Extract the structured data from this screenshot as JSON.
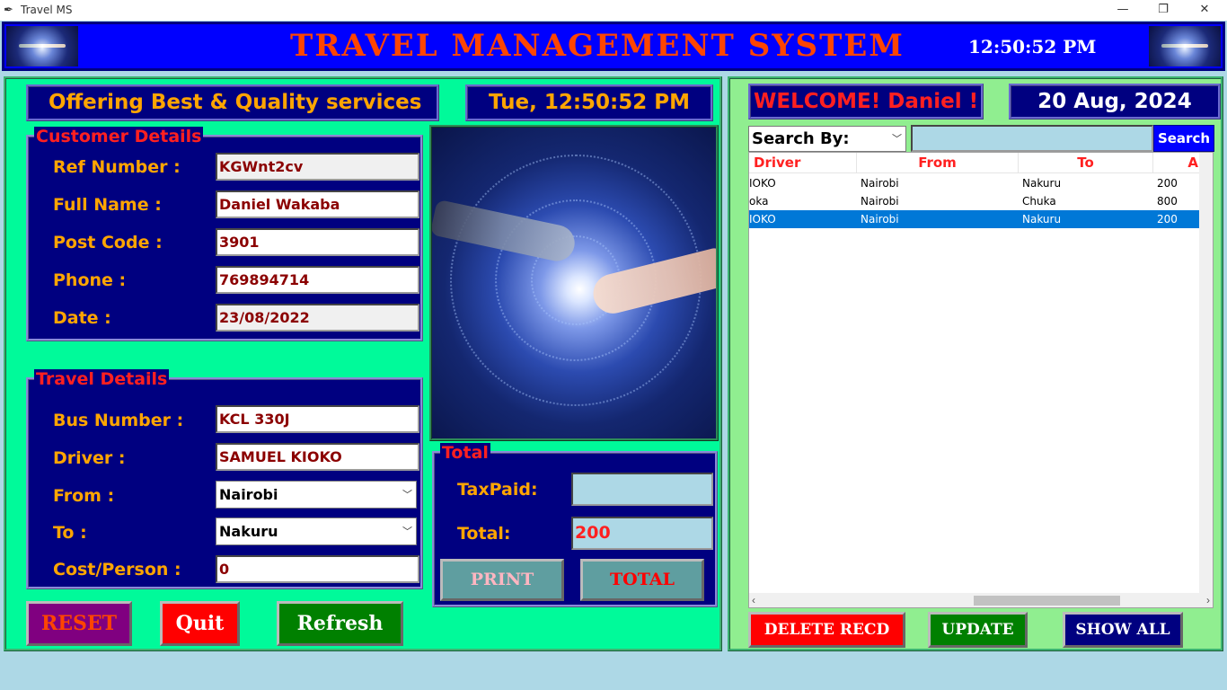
{
  "window": {
    "title": "Travel MS",
    "minimize": "—",
    "restore": "❐",
    "close": "✕",
    "app_icon": "feather-icon"
  },
  "header": {
    "title": "TRAVEL  MANAGEMENT  SYSTEM",
    "clock": "12:50:52 PM"
  },
  "left": {
    "tagline": "Offering Best & Quality services",
    "datetime": "Tue, 12:50:52 PM",
    "customer": {
      "legend": "Customer Details",
      "ref_label": "Ref Number  :",
      "ref_value": "KGWnt2cv",
      "name_label": "Full Name  :",
      "name_value": "Daniel Wakaba",
      "post_label": "Post Code :",
      "post_value": "3901",
      "phone_label": "Phone :",
      "phone_value": "769894714",
      "date_label": "Date :",
      "date_value": "23/08/2022"
    },
    "travel": {
      "legend": "Travel Details",
      "bus_label": "Bus Number :",
      "bus_value": "KCL 330J",
      "driver_label": "Driver :",
      "driver_value": "SAMUEL KIOKO",
      "from_label": "From :",
      "from_value": "Nairobi",
      "to_label": "To :",
      "to_value": "Nakuru",
      "cost_label": "Cost/Person :",
      "cost_value": "0"
    },
    "total": {
      "legend": "Total",
      "tax_label": "TaxPaid:",
      "tax_value": "",
      "total_label": "Total:",
      "total_value": "200",
      "print_btn": "PRINT",
      "total_btn": "TOTAL"
    },
    "buttons": {
      "reset": "RESET",
      "quit": "Quit",
      "refresh": "Refresh"
    }
  },
  "right": {
    "welcome": "WELCOME! Daniel !",
    "date": "20 Aug, 2024",
    "search_by": "Search By:",
    "search_value": "",
    "search_btn": "Search",
    "columns": [
      "Driver",
      "From",
      "To",
      "A"
    ],
    "rows": [
      {
        "driver": "IOKO",
        "from": "Nairobi",
        "to": "Nakuru",
        "amount": "200",
        "selected": false
      },
      {
        "driver": "oka",
        "from": "Nairobi",
        "to": "Chuka",
        "amount": "800",
        "selected": false
      },
      {
        "driver": "IOKO",
        "from": "Nairobi",
        "to": "Nakuru",
        "amount": "200",
        "selected": true
      }
    ],
    "buttons": {
      "delete": "DELETE RECD",
      "update": "UPDATE",
      "show_all": "SHOW ALL"
    }
  },
  "colors": {
    "header_bg": "#0000ff",
    "title": "#ff4500",
    "panel_left": "#00fa9a",
    "panel_right": "#90ee90",
    "navy": "#000080",
    "label": "#ffa500",
    "legend": "#ff2020"
  }
}
